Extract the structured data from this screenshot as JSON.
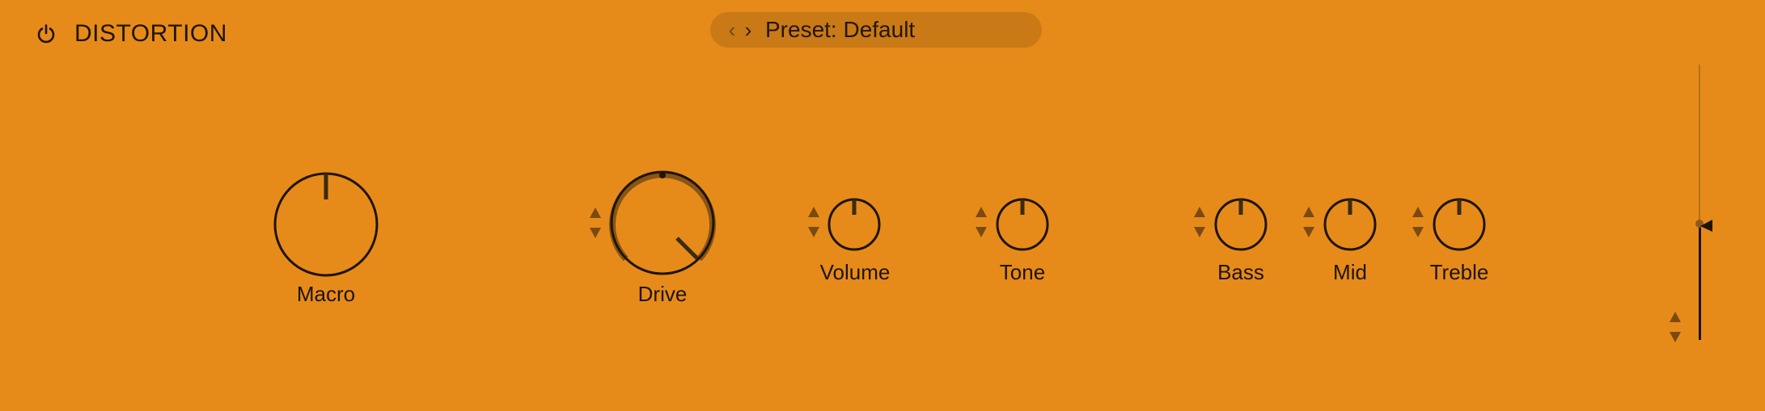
{
  "header": {
    "title": "DISTORTION",
    "power_icon": "power-icon",
    "preset_label": "Preset: Default",
    "prev_icon": "chevron-left-icon",
    "next_icon": "chevron-right-icon"
  },
  "knobs": {
    "macro": {
      "label": "Macro"
    },
    "drive": {
      "label": "Drive"
    },
    "volume": {
      "label": "Volume"
    },
    "tone": {
      "label": "Tone"
    },
    "bass": {
      "label": "Bass"
    },
    "mid": {
      "label": "Mid"
    },
    "treble": {
      "label": "Treble"
    }
  },
  "colors": {
    "background": "#e68b1a",
    "preset_pill": "#c97a16",
    "stroke": "#1e1408",
    "drive_ring": "#8a5414",
    "stepper": "#7a4a10"
  }
}
